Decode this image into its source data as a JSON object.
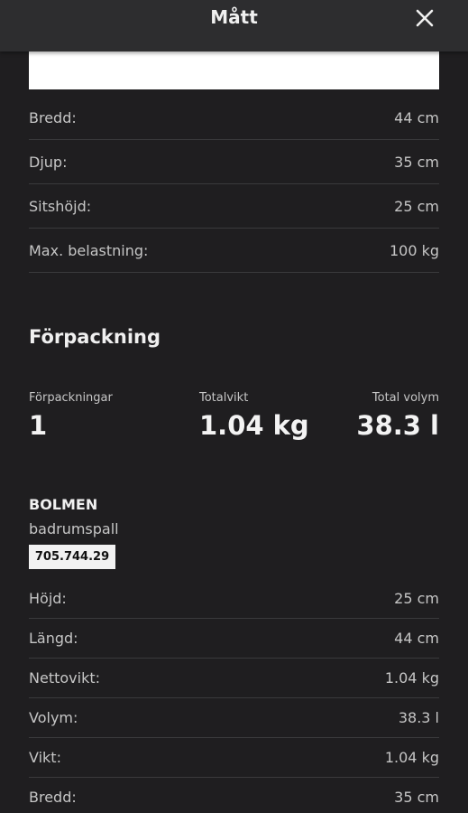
{
  "header": {
    "title": "Mått",
    "close_icon": "close-icon"
  },
  "dimensions": [
    {
      "label": "Bredd:",
      "value": "44 cm"
    },
    {
      "label": "Djup:",
      "value": "35 cm"
    },
    {
      "label": "Sitshöjd:",
      "value": "25 cm"
    },
    {
      "label": "Max. belastning:",
      "value": "100 kg"
    }
  ],
  "packaging": {
    "title": "Förpackning",
    "stats": [
      {
        "label": "Förpackningar",
        "value": "1"
      },
      {
        "label": "Totalvikt",
        "value": "1.04 kg"
      },
      {
        "label": "Total volym",
        "value": "38.3 l"
      }
    ]
  },
  "product": {
    "name": "BOLMEN",
    "description": "badrumspall",
    "article_number": "705.744.29",
    "details": [
      {
        "label": "Höjd:",
        "value": "25 cm"
      },
      {
        "label": "Längd:",
        "value": "44 cm"
      },
      {
        "label": "Nettovikt:",
        "value": "1.04 kg"
      },
      {
        "label": "Volym:",
        "value": "38.3 l"
      },
      {
        "label": "Vikt:",
        "value": "1.04 kg"
      },
      {
        "label": "Bredd:",
        "value": "35 cm"
      }
    ]
  }
}
